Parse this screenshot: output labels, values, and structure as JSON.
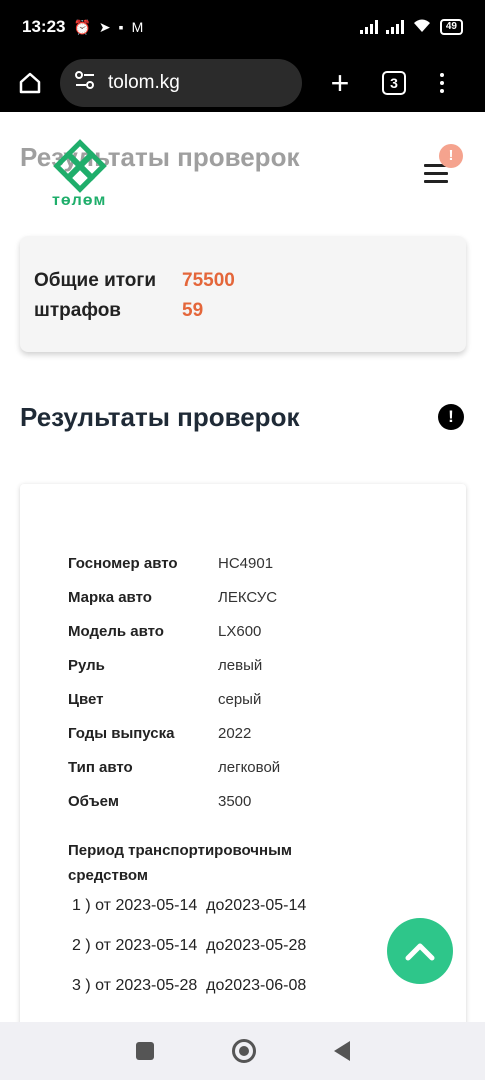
{
  "status_bar": {
    "time": "13:23",
    "battery": "49"
  },
  "browser": {
    "url": "tolom.kg",
    "tab_count": "3"
  },
  "header": {
    "title": "Результаты проверок",
    "logo_text": "төлөм",
    "badge": "!"
  },
  "totals": {
    "label": "Общие итоги штрафов",
    "amount": "75500",
    "count": "59"
  },
  "section": {
    "title": "Результаты проверок",
    "info": "!"
  },
  "vehicle": {
    "rows": [
      {
        "label": "Госномер авто",
        "value": "HC4901"
      },
      {
        "label": "Марка авто",
        "value": "ЛЕКСУС"
      },
      {
        "label": "Модель авто",
        "value": "LX600"
      },
      {
        "label": "Руль",
        "value": "левый"
      },
      {
        "label": "Цвет",
        "value": "серый"
      },
      {
        "label": "Годы выпуска",
        "value": "2022"
      },
      {
        "label": "Тип авто",
        "value": "легковой"
      },
      {
        "label": "Объем",
        "value": "3500"
      }
    ],
    "period_title": "Период транспортировочным средством",
    "periods": [
      "1 ) от 2023-05-14  до2023-05-14",
      "2 ) от 2023-05-14  до2023-05-28",
      "3 ) от 2023-05-28  до2023-06-08"
    ]
  },
  "colors": {
    "accent_green": "#2ec68a",
    "amount_orange": "#e4663a",
    "logo_green": "#1fae6b"
  }
}
